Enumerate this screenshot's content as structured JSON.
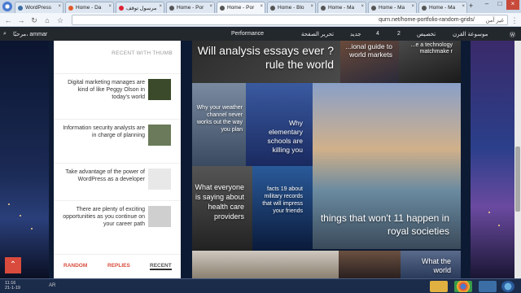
{
  "browser": {
    "tabs": [
      {
        "label": "WordPress",
        "color": "#3a6ea5"
      },
      {
        "label": "Home - Da",
        "color": "#e05a2b"
      },
      {
        "label": "مرسول توقف",
        "color": "#d23"
      },
      {
        "label": "Home - Por",
        "color": "#555"
      },
      {
        "label": "Home - Por",
        "color": "#555",
        "active": true
      },
      {
        "label": "Home - Blo",
        "color": "#555"
      },
      {
        "label": "Home - Ma",
        "color": "#555"
      },
      {
        "label": "Home - Ma",
        "color": "#555"
      },
      {
        "label": "Home - Ma",
        "color": "#555"
      }
    ],
    "new_tab": "+",
    "url": "qurn.net/home-portfolio-random-grids/",
    "url_prefix": "غير آمن",
    "nav": {
      "back": "←",
      "forward": "→",
      "reload": "↻",
      "home": "⌂",
      "star": "☆",
      "menu": "⋮"
    }
  },
  "adminbar": {
    "user": "مرحبًا، ammar",
    "performance": "Performance",
    "items": [
      "تخصيص",
      "2",
      "4",
      "جديد",
      "تحرير الصفحة",
      "موسوعة القرن"
    ],
    "search_icon": "search-icon"
  },
  "sidebar": {
    "heading": "RECENT WITH THUMB",
    "items": [
      {
        "title": "Digital marketing manages are kind of like Peggy Olson in today's world",
        "thumb": "#3b4a2a"
      },
      {
        "title": "Information security analysts are in charge of planning",
        "thumb": "#6a7a5a"
      },
      {
        "title": "Take advantage of the power of WordPress as a developer",
        "thumb": "#e8e8e8"
      },
      {
        "title": "There are plenty of exciting opportunities as you continue on your career path",
        "thumb": "#cfcfcf"
      }
    ],
    "tabs": [
      "RANDOM",
      "REPLIES",
      "RECENT"
    ]
  },
  "grid": {
    "tile1": "Will analysis essays ever ?rule the world",
    "tile2": "...ional guide to world markets",
    "tile3": "...e a technology matchmake r",
    "tile4": "Why your weather channel never works out the way you plan",
    "tile5": "Why elementary schools are killing you",
    "tile6": "things that won't 11 happen in royal societies",
    "tile7": "What everyone is saying about health care providers",
    "tile8": "facts 19 about military records that will impress your friends",
    "tile9": "What the world"
  },
  "taskbar": {
    "time": "11:16",
    "date": "21-1-19",
    "tray": "AR"
  }
}
